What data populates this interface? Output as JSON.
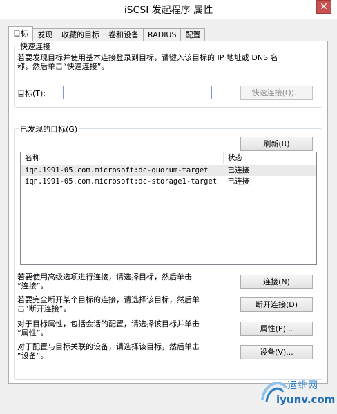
{
  "window": {
    "title": "iSCSI 发起程序 属性",
    "close_label": "✕"
  },
  "tabs": [
    {
      "label": "目标",
      "active": true
    },
    {
      "label": "发现",
      "active": false
    },
    {
      "label": "收藏的目标",
      "active": false
    },
    {
      "label": "卷和设备",
      "active": false
    },
    {
      "label": "RADIUS",
      "active": false
    },
    {
      "label": "配置",
      "active": false
    }
  ],
  "quick_connect": {
    "title": "快速连接",
    "description_line1": "若要发现目标并使用基本连接登录到目标，请键入该目标的 IP 地址或 DNS 名",
    "description_line2": "称，然后单击“快速连接”。",
    "target_label": "目标(T):",
    "target_value": "",
    "button_label": "快速连接(Q)..."
  },
  "discovered": {
    "title": "已发现的目标(G)",
    "refresh_label": "刷新(R)",
    "columns": {
      "name": "名称",
      "status": "状态"
    },
    "rows": [
      {
        "name": "iqn.1991-05.com.microsoft:dc-quorum-target",
        "status": "已连接"
      },
      {
        "name": "iqn.1991-05.com.microsoft:dc-storage1-target",
        "status": "已连接"
      }
    ]
  },
  "actions": {
    "connect": {
      "desc1": "若要使用高级选项进行连接，请选择目标，然后单击",
      "desc2": "“连接”。",
      "button": "连接(N)"
    },
    "disconnect": {
      "desc1": "若要完全断开某个目标的连接，请选择该目标，然后单",
      "desc2": "击“断开连接”。",
      "button": "断开连接(D)"
    },
    "properties": {
      "desc1": "对于目标属性，包括会话的配置，请选择该目标并单击",
      "desc2": "“属性”。",
      "button": "属性(P)..."
    },
    "devices": {
      "desc1": "对于配置与目标关联的设备，请选择该目标，然后单击",
      "desc2": "“设备”。",
      "button": "设备(V)..."
    }
  },
  "watermark": {
    "top": "运维网",
    "bottom": "iyunv.com"
  },
  "colors": {
    "accent": "#2a7fc9",
    "close": "#c75050"
  }
}
